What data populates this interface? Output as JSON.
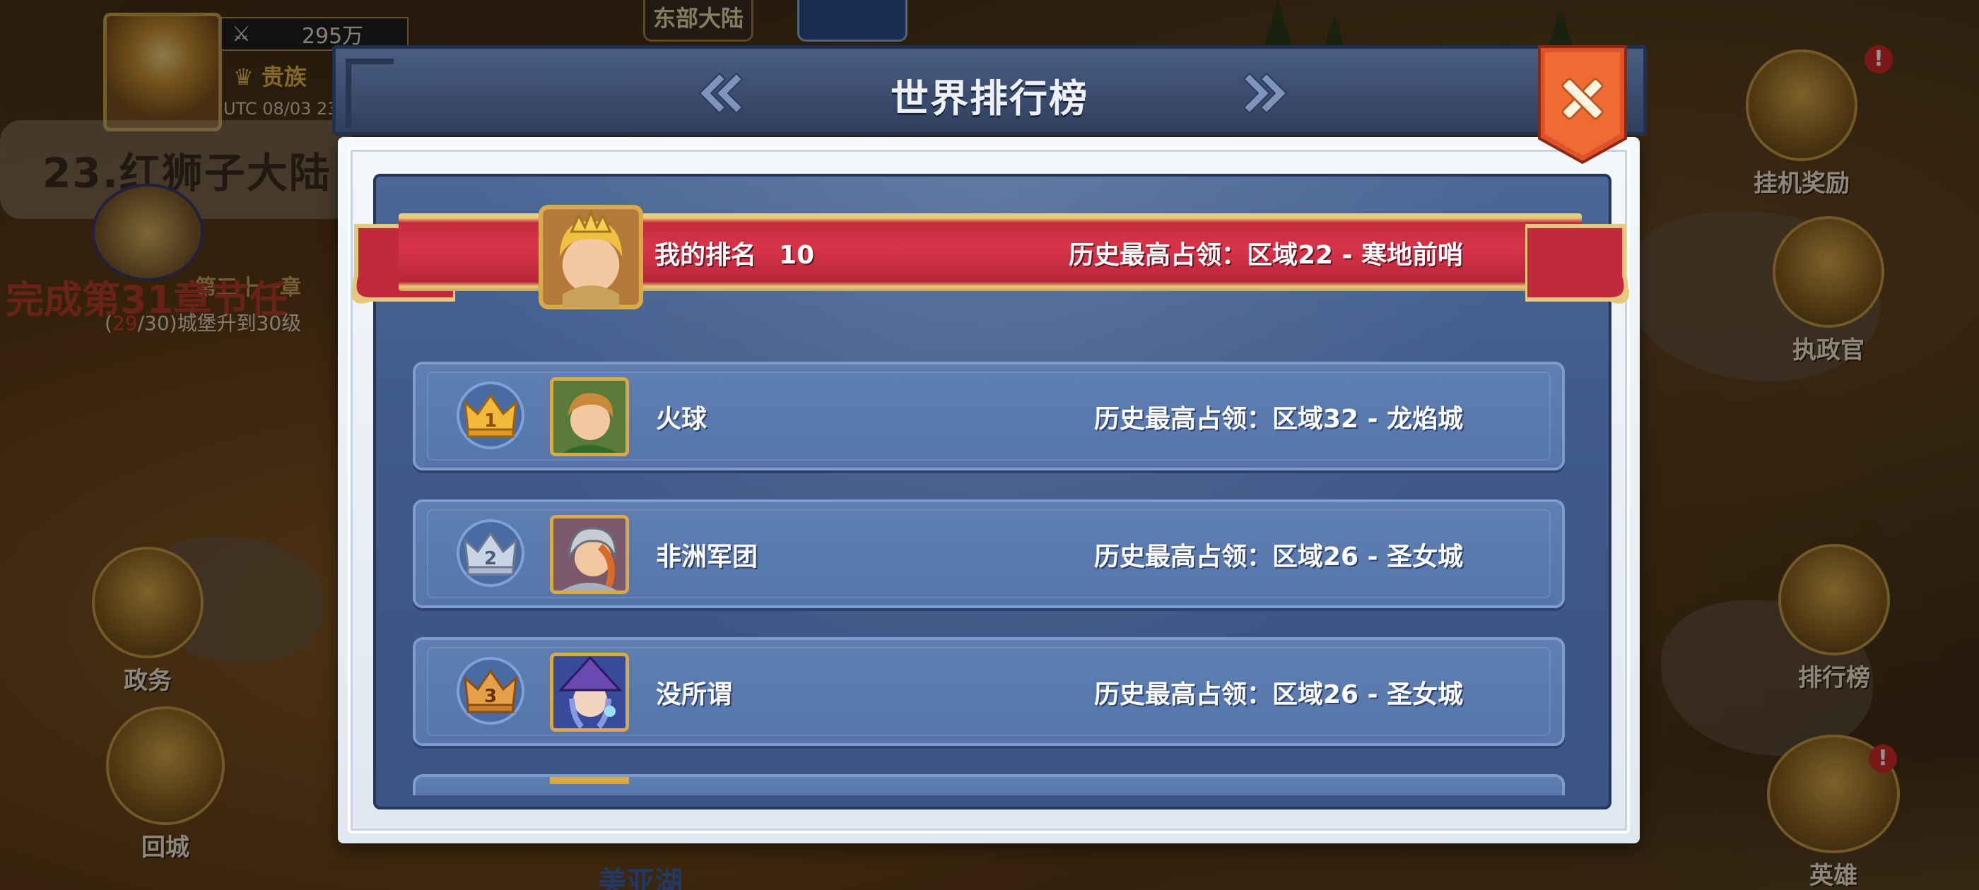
{
  "hud": {
    "region_tab": "东部大陆",
    "power": "295万",
    "noble_label": "贵族",
    "utc_time": "UTC 08/03 23:",
    "continent_title": "23.红狮子大陆",
    "task_title": "完成第31章节任",
    "chapter_label": "第三十一章",
    "task_progress_current": "29",
    "task_progress_rest": "/30)城堡升到30级",
    "task_progress_open": "(",
    "map_label": "美亚湖"
  },
  "side_buttons": {
    "left": [
      {
        "label": "政务"
      },
      {
        "label": "回城"
      }
    ],
    "right": [
      {
        "label": "挂机奖励",
        "badge": "!"
      },
      {
        "label": "执政官"
      },
      {
        "label": "排行榜"
      },
      {
        "label": "英雄",
        "badge": "!"
      }
    ]
  },
  "dialog": {
    "title": "世界排行榜",
    "my_rank": {
      "label": "我的排名",
      "rank": "10",
      "history": "历史最高占领：区域22 - 寒地前哨"
    },
    "rows": [
      {
        "rank": "1",
        "name": "火球",
        "history": "历史最高占领：区域32 - 龙焰城"
      },
      {
        "rank": "2",
        "name": "非洲军团",
        "history": "历史最高占领：区域26 - 圣女城"
      },
      {
        "rank": "3",
        "name": "没所谓",
        "history": "历史最高占领：区域26 - 圣女城"
      }
    ]
  },
  "colors": {
    "gold": "#d7a948",
    "silver": "#b9c6d8",
    "bronze": "#d08a3a",
    "ribbon_red": "#d8344a",
    "panel_blue": "#3f5a8a",
    "close_red": "#e0532a"
  },
  "icons": {
    "prev": "double-chevron-left-icon",
    "next": "double-chevron-right-icon",
    "close": "close-x-icon",
    "rank": "crown-icon"
  }
}
